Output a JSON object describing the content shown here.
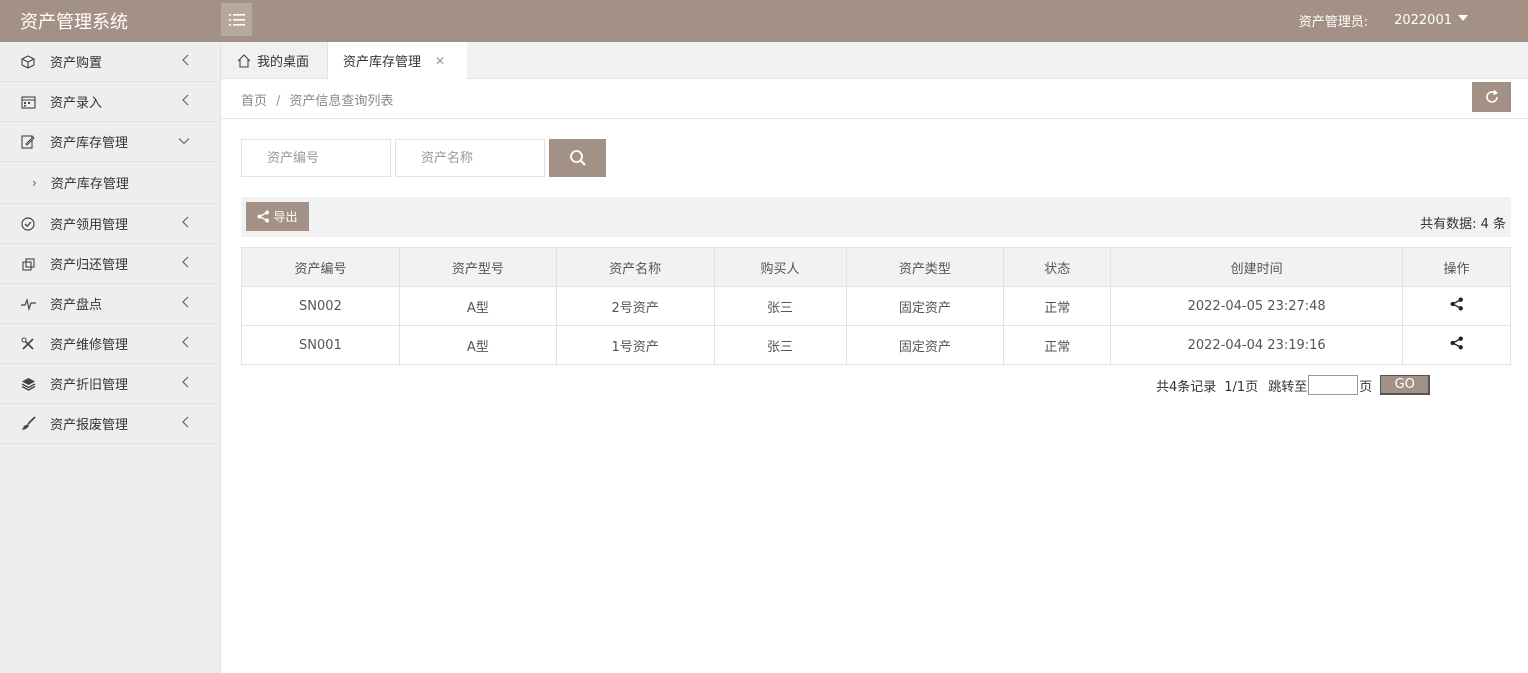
{
  "header": {
    "app_title": "资产管理系统",
    "user_label": "资产管理员:",
    "user_id": "2022001",
    "brand_color": "#a39185"
  },
  "sidebar": {
    "items": [
      {
        "label": "资产购置",
        "icon": "cube-icon"
      },
      {
        "label": "资产录入",
        "icon": "calendar-icon"
      },
      {
        "label": "资产库存管理",
        "icon": "edit-note-icon",
        "expanded": true
      },
      {
        "label": "资产领用管理",
        "icon": "check-circle-icon"
      },
      {
        "label": "资产归还管理",
        "icon": "return-icon"
      },
      {
        "label": "资产盘点",
        "icon": "pulse-icon"
      },
      {
        "label": "资产维修管理",
        "icon": "tools-icon"
      },
      {
        "label": "资产折旧管理",
        "icon": "layers-icon"
      },
      {
        "label": "资产报废管理",
        "icon": "brush-icon"
      }
    ],
    "sub_item": "资产库存管理"
  },
  "tabs": {
    "home": "我的桌面",
    "active": "资产库存管理"
  },
  "breadcrumb": {
    "home": "首页",
    "current": "资产信息查询列表"
  },
  "search": {
    "code_placeholder": "资产编号",
    "name_placeholder": "资产名称"
  },
  "toolbar": {
    "export_label": "导出",
    "total_text": "共有数据: 4 条"
  },
  "table": {
    "columns": [
      "资产编号",
      "资产型号",
      "资产名称",
      "购买人",
      "资产类型",
      "状态",
      "创建时间",
      "操作"
    ],
    "rows": [
      {
        "code": "SN002",
        "model": "A型",
        "name": "2号资产",
        "buyer": "张三",
        "type": "固定资产",
        "status": "正常",
        "created": "2022-04-05 23:27:48"
      },
      {
        "code": "SN001",
        "model": "A型",
        "name": "1号资产",
        "buyer": "张三",
        "type": "固定资产",
        "status": "正常",
        "created": "2022-04-04 23:19:16"
      }
    ]
  },
  "pager": {
    "total": "共4条记录",
    "page_info": "1/1页",
    "jump_label": "跳转至",
    "page_unit": "页",
    "go_label": "GO"
  }
}
